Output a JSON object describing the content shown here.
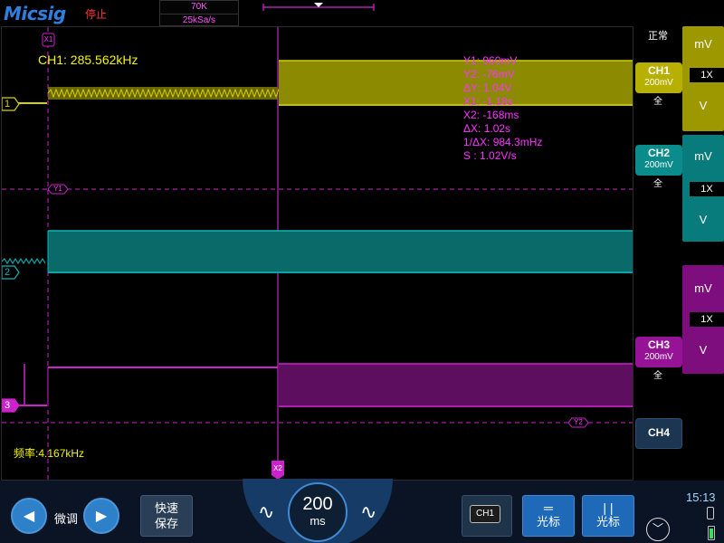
{
  "brand": "Micsig",
  "status": {
    "run_state": "停止",
    "mode": "正常"
  },
  "acquisition": {
    "memory_depth": "70K",
    "sample_rate": "25kSa/s"
  },
  "measurements": {
    "ch1_frequency": "CH1: 285.562kHz",
    "bottom_frequency": "频率:4.167kHz"
  },
  "cursor_readout": [
    "Y1:  960mV",
    "Y2:  -76mV",
    "ΔY:  1.04V",
    "X1:  -1.18s",
    "X2:  -168ms",
    "ΔX:  1.02s",
    "1/ΔX:  984.3mHz",
    "S :  1.02V/s"
  ],
  "markers": {
    "x1": "X1",
    "x2": "X2",
    "y1": "Y1",
    "y2": "Y2",
    "ch1": "1",
    "ch2": "2",
    "ch3": "3"
  },
  "channels": [
    {
      "name": "CH1",
      "scale": "200mV",
      "coupling": "全",
      "unit_top": "mV",
      "probe": "1X",
      "unit_bottom": "V",
      "color": "#b8b000"
    },
    {
      "name": "CH2",
      "scale": "200mV",
      "coupling": "全",
      "unit_top": "mV",
      "probe": "1X",
      "unit_bottom": "V",
      "color": "#0b8c8c"
    },
    {
      "name": "CH3",
      "scale": "200mV",
      "coupling": "全",
      "unit_top": "mV",
      "probe": "1X",
      "unit_bottom": "V",
      "color": "#961296"
    },
    {
      "name": "CH4"
    }
  ],
  "bottom": {
    "fine_adjust": "微调",
    "quick_save_line1": "快速",
    "quick_save_line2": "保存",
    "timebase_value": "200",
    "timebase_unit": "ms",
    "source_chip": "CH1",
    "cursor_h_label": "光标",
    "cursor_v_label": "光标",
    "time": "15:13"
  },
  "colors": {
    "ch1": "#d8d000",
    "ch2": "#10a9a9",
    "ch3": "#cc22cc",
    "accent": "#2e80c8"
  },
  "icons": [
    "left-arrow-icon",
    "right-arrow-icon",
    "sine-wave-icon",
    "cursor-horizontal-icon",
    "cursor-vertical-icon",
    "collapse-chevron-icon",
    "usb-icon",
    "battery-icon"
  ]
}
